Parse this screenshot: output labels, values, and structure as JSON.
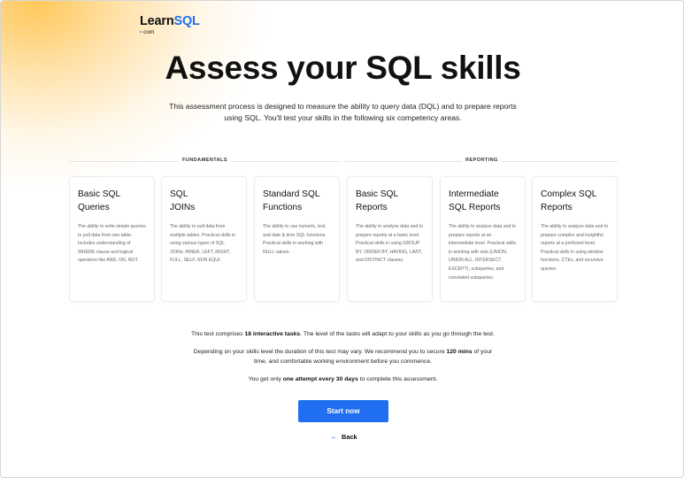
{
  "brand": {
    "name_part1": "Learn",
    "name_part2": "SQL",
    "domain_dot": "•",
    "domain": "com",
    "accent_color": "#1f6ff0",
    "glow_color": "#ffbe3c"
  },
  "page": {
    "title": "Assess your SQL skills",
    "intro": "This assessment process is designed to measure the ability to query data (DQL) and to prepare reports using SQL. You'll test your skills in the following six competency areas."
  },
  "groups": [
    {
      "label": "FUNDAMENTALS"
    },
    {
      "label": "REPORTING"
    }
  ],
  "cards": [
    {
      "title": "Basic SQL\nQueries",
      "desc": "The ability to write simple queries to pull data from one table. Includes understanding of WHERE clause and logical operators like AND, OR, NOT."
    },
    {
      "title": "SQL\nJOINs",
      "desc": "The ability to pull data from multiple tables. Practical skills in using various types of SQL JOINs: INNER, LEFT, RIGHT, FULL, SELF, NON EQUI."
    },
    {
      "title": "Standard SQL\nFunctions",
      "desc": "The ability to use numeric, text, and date & time SQL functions. Practical skills in working with NULL values."
    },
    {
      "title": "Basic SQL\nReports",
      "desc": "The ability to analyze data and to prepare reports at a basic level. Practical skills in using GROUP BY, ORDER BY, HAVING, LIMIT, and DISTINCT clauses."
    },
    {
      "title": "Intermediate\nSQL Reports",
      "desc": "The ability to analyze data and to prepare reports at an intermediate level. Practical skills in working with sets (UNION, UNION ALL, INTERSECT, EXCEPT), subqueries, and correlated subqueries."
    },
    {
      "title": "Complex SQL\nReports",
      "desc": "The ability to analyze data and to prepare complex and insightful reports at a proficient level. Practical skills in using window functions, CTEs, and recursive queries."
    }
  ],
  "info": {
    "line1_pre": "This test comprises ",
    "line1_bold": "18 interactive tasks",
    "line1_post": ". The level of the tasks will adapt to your skills as you go through the test.",
    "line2_pre": "Depending on your skills level the duration of this test may vary. We recommend you to secure ",
    "line2_bold": "120 mins",
    "line2_post": " of your time, and comfortable working environment before you commence.",
    "line3_pre": "You get only ",
    "line3_bold": "one attempt every 30 days",
    "line3_post": " to complete this assessment."
  },
  "actions": {
    "start_label": "Start now",
    "back_arrow": "←",
    "back_label": "Back"
  }
}
